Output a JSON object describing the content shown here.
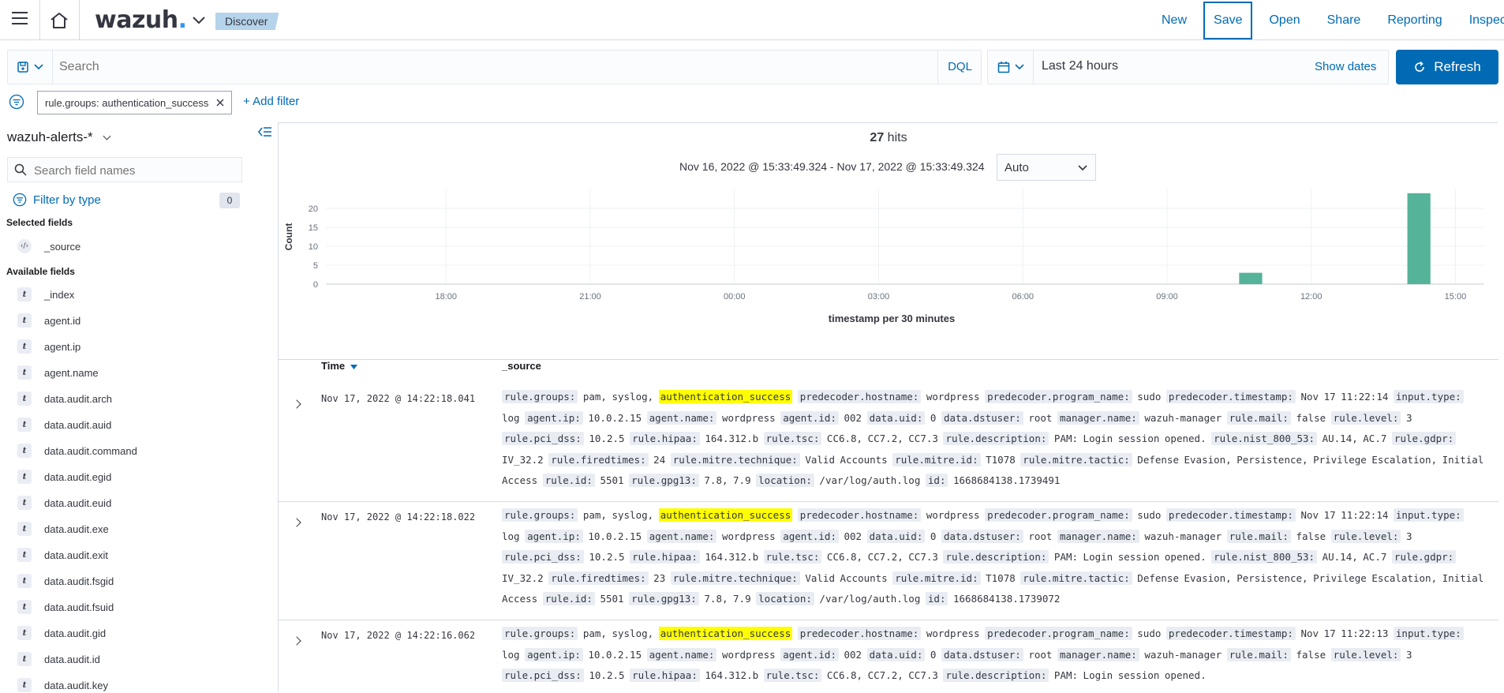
{
  "header": {
    "logo_text": "wazuh",
    "logo_dot": ".",
    "breadcrumb": "Discover",
    "nav": [
      "New",
      "Save",
      "Open",
      "Share",
      "Reporting",
      "Inspect"
    ]
  },
  "query": {
    "search_placeholder": "Search",
    "language": "DQL",
    "time_range": "Last 24 hours",
    "show_dates": "Show dates",
    "refresh": "Refresh"
  },
  "filters": {
    "active": "rule.groups: authentication_success",
    "add_filter": "+ Add filter"
  },
  "sidebar": {
    "index_pattern": "wazuh-alerts-*",
    "search_placeholder": "Search field names",
    "filter_by_type": "Filter by type",
    "filter_count": "0",
    "selected_heading": "Selected fields",
    "selected_fields": [
      "_source"
    ],
    "available_heading": "Available fields",
    "available_fields": [
      "_index",
      "agent.id",
      "agent.ip",
      "agent.name",
      "data.audit.arch",
      "data.audit.auid",
      "data.audit.command",
      "data.audit.egid",
      "data.audit.euid",
      "data.audit.exe",
      "data.audit.exit",
      "data.audit.fsgid",
      "data.audit.fsuid",
      "data.audit.gid",
      "data.audit.id",
      "data.audit.key"
    ]
  },
  "hits": {
    "count": "27",
    "label": "hits",
    "range": "Nov 16, 2022 @ 15:33:49.324 - Nov 17, 2022 @ 15:33:49.324",
    "interval": "Auto"
  },
  "chart_data": {
    "type": "bar",
    "xlabel": "timestamp per 30 minutes",
    "ylabel": "Count",
    "x_tick_labels": [
      "18:00",
      "21:00",
      "00:00",
      "03:00",
      "06:00",
      "09:00",
      "12:00",
      "15:00"
    ],
    "y_ticks": [
      0,
      5,
      10,
      15,
      20
    ],
    "ylim": [
      0,
      25
    ],
    "x_range_hours": [
      15.5,
      39.6
    ],
    "bars": [
      {
        "start_hour": 34.5,
        "value": 3
      },
      {
        "start_hour": 38.0,
        "value": 24
      }
    ],
    "color": "#54b399",
    "grid": true
  },
  "table": {
    "col_time": "Time",
    "col_source": "_source",
    "rows": [
      {
        "time": "Nov 17, 2022 @ 14:22:18.041",
        "fields": [
          [
            "rule.groups:",
            "pam, syslog, ",
            "authentication_success"
          ],
          [
            "predecoder.hostname:",
            "wordpress"
          ],
          [
            "predecoder.program_name:",
            "sudo"
          ],
          [
            "predecoder.timestamp:",
            "Nov 17 11:22:14"
          ],
          [
            "input.type:",
            "log"
          ],
          [
            "agent.ip:",
            "10.0.2.15"
          ],
          [
            "agent.name:",
            "wordpress"
          ],
          [
            "agent.id:",
            "002"
          ],
          [
            "data.uid:",
            "0"
          ],
          [
            "data.dstuser:",
            "root"
          ],
          [
            "manager.name:",
            "wazuh-manager"
          ],
          [
            "rule.mail:",
            "false"
          ],
          [
            "rule.level:",
            "3"
          ],
          [
            "rule.pci_dss:",
            "10.2.5"
          ],
          [
            "rule.hipaa:",
            "164.312.b"
          ],
          [
            "rule.tsc:",
            "CC6.8, CC7.2, CC7.3"
          ],
          [
            "rule.description:",
            "PAM: Login session opened."
          ],
          [
            "rule.nist_800_53:",
            "AU.14, AC.7"
          ],
          [
            "rule.gdpr:",
            "IV_32.2"
          ],
          [
            "rule.firedtimes:",
            "24"
          ],
          [
            "rule.mitre.technique:",
            "Valid Accounts"
          ],
          [
            "rule.mitre.id:",
            "T1078"
          ],
          [
            "rule.mitre.tactic:",
            "Defense Evasion, Persistence, Privilege Escalation, Initial Access"
          ],
          [
            "rule.id:",
            "5501"
          ],
          [
            "rule.gpg13:",
            "7.8, 7.9"
          ],
          [
            "location:",
            "/var/log/auth.log"
          ],
          [
            "id:",
            "1668684138.1739491"
          ]
        ]
      },
      {
        "time": "Nov 17, 2022 @ 14:22:18.022",
        "fields": [
          [
            "rule.groups:",
            "pam, syslog, ",
            "authentication_success"
          ],
          [
            "predecoder.hostname:",
            "wordpress"
          ],
          [
            "predecoder.program_name:",
            "sudo"
          ],
          [
            "predecoder.timestamp:",
            "Nov 17 11:22:14"
          ],
          [
            "input.type:",
            "log"
          ],
          [
            "agent.ip:",
            "10.0.2.15"
          ],
          [
            "agent.name:",
            "wordpress"
          ],
          [
            "agent.id:",
            "002"
          ],
          [
            "data.uid:",
            "0"
          ],
          [
            "data.dstuser:",
            "root"
          ],
          [
            "manager.name:",
            "wazuh-manager"
          ],
          [
            "rule.mail:",
            "false"
          ],
          [
            "rule.level:",
            "3"
          ],
          [
            "rule.pci_dss:",
            "10.2.5"
          ],
          [
            "rule.hipaa:",
            "164.312.b"
          ],
          [
            "rule.tsc:",
            "CC6.8, CC7.2, CC7.3"
          ],
          [
            "rule.description:",
            "PAM: Login session opened."
          ],
          [
            "rule.nist_800_53:",
            "AU.14, AC.7"
          ],
          [
            "rule.gdpr:",
            "IV_32.2"
          ],
          [
            "rule.firedtimes:",
            "23"
          ],
          [
            "rule.mitre.technique:",
            "Valid Accounts"
          ],
          [
            "rule.mitre.id:",
            "T1078"
          ],
          [
            "rule.mitre.tactic:",
            "Defense Evasion, Persistence, Privilege Escalation, Initial Access"
          ],
          [
            "rule.id:",
            "5501"
          ],
          [
            "rule.gpg13:",
            "7.8, 7.9"
          ],
          [
            "location:",
            "/var/log/auth.log"
          ],
          [
            "id:",
            "1668684138.1739072"
          ]
        ]
      },
      {
        "time": "Nov 17, 2022 @ 14:22:16.062",
        "fields": [
          [
            "rule.groups:",
            "pam, syslog, ",
            "authentication_success"
          ],
          [
            "predecoder.hostname:",
            "wordpress"
          ],
          [
            "predecoder.program_name:",
            "sudo"
          ],
          [
            "predecoder.timestamp:",
            "Nov 17 11:22:13"
          ],
          [
            "input.type:",
            "log"
          ],
          [
            "agent.ip:",
            "10.0.2.15"
          ],
          [
            "agent.name:",
            "wordpress"
          ],
          [
            "agent.id:",
            "002"
          ],
          [
            "data.uid:",
            "0"
          ],
          [
            "data.dstuser:",
            "root"
          ],
          [
            "manager.name:",
            "wazuh-manager"
          ],
          [
            "rule.mail:",
            "false"
          ],
          [
            "rule.level:",
            "3"
          ],
          [
            "rule.pci_dss:",
            "10.2.5"
          ],
          [
            "rule.hipaa:",
            "164.312.b"
          ],
          [
            "rule.tsc:",
            "CC6.8, CC7.2, CC7.3"
          ],
          [
            "rule.description:",
            "PAM: Login session opened."
          ]
        ]
      }
    ]
  }
}
